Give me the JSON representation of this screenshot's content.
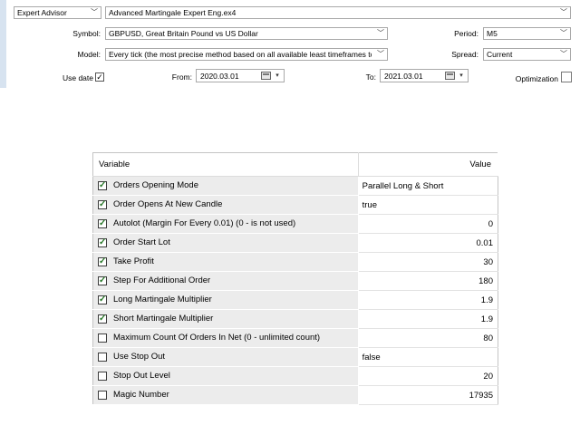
{
  "settings": {
    "expert_type": "Expert Advisor",
    "expert_file": "Advanced Martingale Expert Eng.ex4",
    "symbol_label": "Symbol:",
    "symbol_value": "GBPUSD, Great Britain Pound vs US Dollar",
    "period_label": "Period:",
    "period_value": "M5",
    "model_label": "Model:",
    "model_value": "Every tick (the most precise method based on all available least timeframes to",
    "spread_label": "Spread:",
    "spread_value": "Current",
    "use_date_label": "Use date",
    "use_date_checked": true,
    "from_label": "From:",
    "from_value": "2020.03.01",
    "to_label": "To:",
    "to_value": "2021.03.01",
    "optimization_label": "Optimization",
    "optimization_checked": false
  },
  "table": {
    "col_variable": "Variable",
    "col_value": "Value",
    "rows": [
      {
        "name": "Orders Opening Mode",
        "value": "Parallel Long & Short",
        "checked": true,
        "align": "left"
      },
      {
        "name": "Order Opens At New Candle",
        "value": "true",
        "checked": true,
        "align": "left"
      },
      {
        "name": "Autolot (Margin For Every 0.01) (0 - is not used)",
        "value": "0",
        "checked": true,
        "align": "right"
      },
      {
        "name": "Order Start Lot",
        "value": "0.01",
        "checked": true,
        "align": "right"
      },
      {
        "name": "Take Profit",
        "value": "30",
        "checked": true,
        "align": "right"
      },
      {
        "name": "Step For Additional Order",
        "value": "180",
        "checked": true,
        "align": "right"
      },
      {
        "name": "Long Martingale Multiplier",
        "value": "1.9",
        "checked": true,
        "align": "right"
      },
      {
        "name": "Short Martingale Multiplier",
        "value": "1.9",
        "checked": true,
        "align": "right"
      },
      {
        "name": "Maximum Count Of Orders In Net (0 - unlimited count)",
        "value": "80",
        "checked": false,
        "align": "right"
      },
      {
        "name": "Use Stop Out",
        "value": "false",
        "checked": false,
        "align": "left"
      },
      {
        "name": "Stop Out Level",
        "value": "20",
        "checked": false,
        "align": "right"
      },
      {
        "name": "Magic Number",
        "value": "17935",
        "checked": false,
        "align": "right"
      }
    ]
  },
  "icons": {
    "dropdown": "chevron-down-icon",
    "calendar": "calendar-icon",
    "check": "checkmark-icon"
  }
}
